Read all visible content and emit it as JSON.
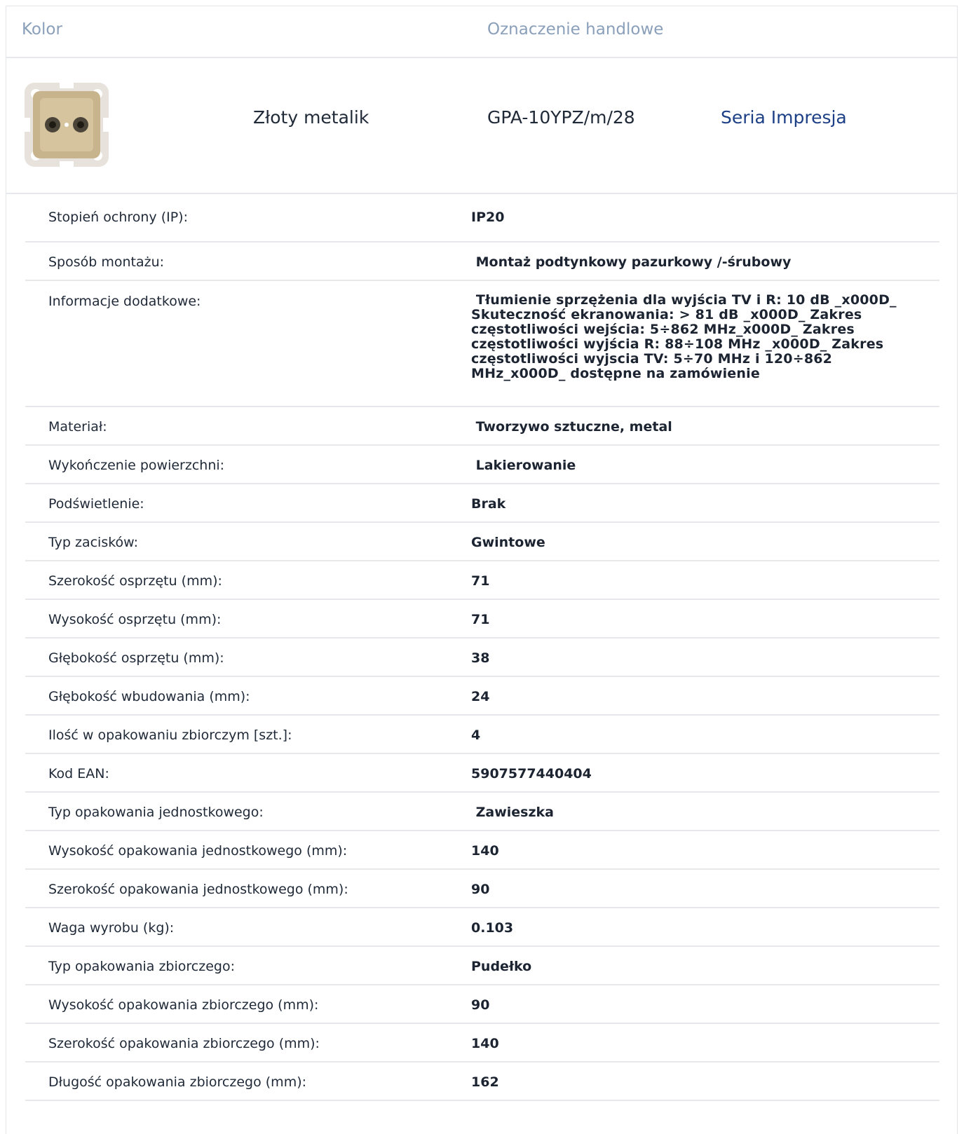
{
  "header": {
    "kolor_label": "Kolor",
    "oznaczenie_label": "Oznaczenie handlowe"
  },
  "product": {
    "image_icon": "socket-thumbnail-icon",
    "color_name": "Złoty metalik",
    "trade_code": "GPA-10YPZ/m/28",
    "series_link": "Seria Impresja"
  },
  "colors": {
    "header_text": "#8a9fb9",
    "link": "#1c3f85",
    "divider": "#e6e8ec"
  },
  "specs": [
    {
      "label": "Stopień ochrony (IP):",
      "value": "IP20"
    },
    {
      "label": "Sposób montażu:",
      "value": " Montaż podtynkowy pazurkowy /-śrubowy"
    },
    {
      "label": "Informacje dodatkowe:",
      "value": " Tłumienie sprzężenia dla wyjścia TV i R: 10 dB _x000D_ Skuteczność ekranowania: > 81 dB _x000D_ Zakres częstotliwości wejścia: 5÷862 MHz_x000D_ Zakres częstotliwości wyjścia R: 88÷108 MHz _x000D_ Zakres częstotliwości wyjscia TV: 5÷70 MHz i 120÷862 MHz_x000D_ dostępne na zamówienie"
    },
    {
      "label": "Materiał:",
      "value": " Tworzywo sztuczne, metal"
    },
    {
      "label": "Wykończenie powierzchni:",
      "value": " Lakierowanie"
    },
    {
      "label": "Podświetlenie:",
      "value": "Brak"
    },
    {
      "label": "Typ zacisków:",
      "value": "Gwintowe"
    },
    {
      "label": "Szerokość osprzętu (mm):",
      "value": "71"
    },
    {
      "label": "Wysokość osprzętu (mm):",
      "value": "71"
    },
    {
      "label": "Głębokość osprzętu (mm):",
      "value": "38"
    },
    {
      "label": "Głębokość wbudowania (mm):",
      "value": "24"
    },
    {
      "label": "Ilość w opakowaniu zbiorczym [szt.]:",
      "value": "4"
    },
    {
      "label": "Kod EAN:",
      "value": "5907577440404"
    },
    {
      "label": "Typ opakowania jednostkowego:",
      "value": " Zawieszka"
    },
    {
      "label": "Wysokość opakowania jednostkowego (mm):",
      "value": "140"
    },
    {
      "label": "Szerokość opakowania jednostkowego (mm):",
      "value": "90"
    },
    {
      "label": "Waga wyrobu (kg):",
      "value": "0.103"
    },
    {
      "label": "Typ opakowania zbiorczego:",
      "value": "Pudełko"
    },
    {
      "label": "Wysokość opakowania zbiorczego (mm):",
      "value": "90"
    },
    {
      "label": "Szerokość opakowania zbiorczego (mm):",
      "value": "140"
    },
    {
      "label": "Długość opakowania zbiorczego (mm):",
      "value": "162"
    }
  ]
}
